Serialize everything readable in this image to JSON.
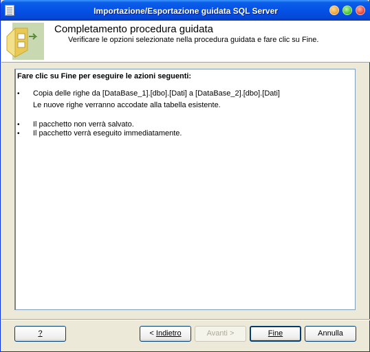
{
  "window": {
    "title": "Importazione/Esportazione guidata SQL Server"
  },
  "header": {
    "title": "Completamento procedura guidata",
    "subtitle": "Verificare le opzioni selezionate nella procedura guidata e fare clic su Fine."
  },
  "summary": {
    "heading": "Fare clic su Fine per eseguire le azioni seguenti:",
    "bullet": "•",
    "items": [
      "Copia delle righe da [DataBase_1].[dbo].[Dati] a [DataBase_2].[dbo].[Dati]",
      "Le nuove righe verranno accodate alla tabella esistente.",
      "Il pacchetto non verrà salvato.",
      "Il pacchetto verrà eseguito immediatamente."
    ]
  },
  "buttons": {
    "help_label": "?",
    "back_prefix": "< ",
    "back_label": "Indietro",
    "next_label": "Avanti >",
    "finish_label": "Fine",
    "cancel_label": "Annulla"
  },
  "colors": {
    "titlebar": "#0551e6",
    "accent": "#003c74"
  }
}
